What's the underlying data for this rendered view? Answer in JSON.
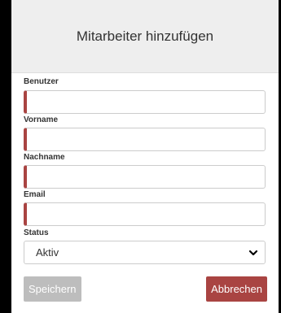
{
  "dialog": {
    "title": "Mitarbeiter hinzufügen"
  },
  "form": {
    "fields": [
      {
        "label": "Benutzer",
        "value": ""
      },
      {
        "label": "Vorname",
        "value": ""
      },
      {
        "label": "Nachname",
        "value": ""
      },
      {
        "label": "Email",
        "value": ""
      }
    ],
    "status": {
      "label": "Status",
      "selected": "Aktiv",
      "icon": "chevron-down-icon"
    }
  },
  "buttons": {
    "save_label": "Speichern",
    "cancel_label": "Abbrechen"
  },
  "colors": {
    "accent": "#a94442",
    "disabled": "#bdbdbd",
    "header_bg": "#eeeeee"
  }
}
